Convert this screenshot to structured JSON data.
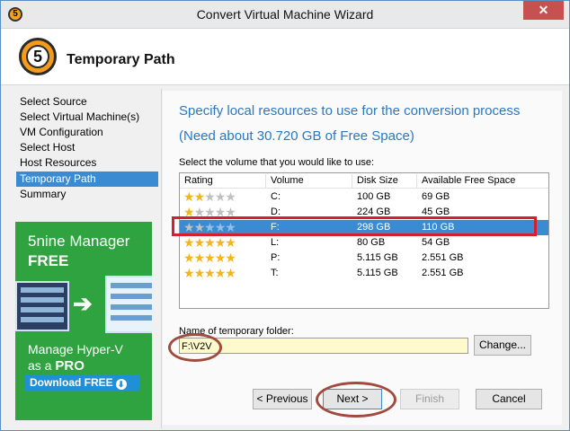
{
  "window": {
    "title": "Convert Virtual Machine Wizard",
    "close_label": "✕"
  },
  "header": {
    "step_number": "5",
    "title": "Temporary Path"
  },
  "sidebar": {
    "items": [
      {
        "label": "Select Source"
      },
      {
        "label": "Select Virtual Machine(s)"
      },
      {
        "label": "VM Configuration"
      },
      {
        "label": "Select Host"
      },
      {
        "label": "Host Resources"
      },
      {
        "label": "Temporary Path"
      },
      {
        "label": "Summary"
      }
    ],
    "active_index": 5
  },
  "ad": {
    "title": "5nine Manager",
    "free": "FREE",
    "line1": "Manage Hyper-V",
    "line2_prefix": "as a",
    "line2_bold": "PRO",
    "button": "Download FREE",
    "arrow": "➔"
  },
  "main": {
    "heading1": "Specify local resources to use for the conversion process",
    "heading2": "(Need about 30.720 GB of Free Space)",
    "select_label": "Select the volume that you would like to use:",
    "columns": [
      "Rating",
      "Volume",
      "Disk Size",
      "Available Free Space"
    ],
    "rows": [
      {
        "rating": 2,
        "volume": "C:",
        "disk_size": "100 GB",
        "free": "69 GB"
      },
      {
        "rating": 1,
        "volume": "D:",
        "disk_size": "224 GB",
        "free": "45 GB"
      },
      {
        "rating": 2,
        "volume": "F:",
        "disk_size": "298 GB",
        "free": "110 GB"
      },
      {
        "rating": 5,
        "volume": "L:",
        "disk_size": "80 GB",
        "free": "54 GB"
      },
      {
        "rating": 5,
        "volume": "P:",
        "disk_size": "5.115 GB",
        "free": "2.551 GB"
      },
      {
        "rating": 5,
        "volume": "T:",
        "disk_size": "5.115 GB",
        "free": "2.551 GB"
      }
    ],
    "selected_row": 2,
    "folder_label": "Name of temporary folder:",
    "folder_value": "F:\\V2V",
    "change_button": "Change..."
  },
  "footer": {
    "previous": "< Previous",
    "next": "Next >",
    "finish": "Finish",
    "cancel": "Cancel"
  },
  "colors": {
    "accent": "#3a8bd1",
    "heading": "#2a78c2",
    "annotation_red": "#d31f2f",
    "annotation_oval": "#a24a3d",
    "ad_green": "#2fa33f",
    "folder_bg": "#fffacb"
  }
}
